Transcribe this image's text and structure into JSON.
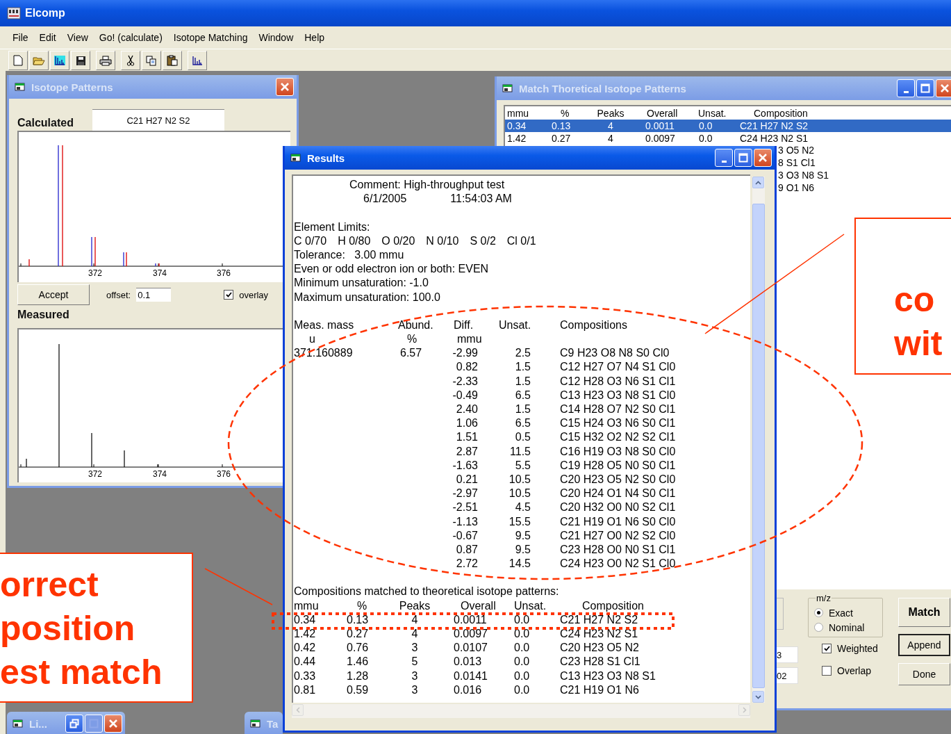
{
  "app": {
    "title": "Elcomp"
  },
  "menu": [
    "File",
    "Edit",
    "View",
    "Go! (calculate)",
    "Isotope Matching",
    "Window",
    "Help"
  ],
  "toolbar": [
    [
      {
        "kind": "new",
        "selected": false
      },
      {
        "kind": "open",
        "selected": false
      },
      {
        "kind": "spectrum",
        "selected": true
      },
      {
        "kind": "save",
        "selected": false
      }
    ],
    [
      {
        "kind": "print",
        "selected": false
      }
    ],
    [
      {
        "kind": "cut",
        "selected": false
      },
      {
        "kind": "copy",
        "selected": false
      },
      {
        "kind": "paste",
        "selected": false
      }
    ],
    [
      {
        "kind": "spectrum",
        "selected": false
      }
    ]
  ],
  "isotope_window": {
    "title": "Isotope Patterns",
    "calculated_label": "Calculated",
    "formula": "C21 H27 N2 S2",
    "calculated_ticks": [
      "372",
      "374",
      "376"
    ],
    "accept": "Accept",
    "offset_label": "offset:",
    "offset_value": "0.1",
    "overlay": {
      "label": "overlay",
      "checked": true
    },
    "measured_label": "Measured",
    "measured_ticks": [
      "372",
      "374",
      "376"
    ]
  },
  "match_window": {
    "title": "Match Thoretical Isotope Patterns",
    "columns": [
      "mmu",
      "%",
      "Peaks",
      "Overall",
      "Unsat.",
      "Composition"
    ],
    "rows": [
      {
        "mmu": "0.34",
        "pct": "0.13",
        "peaks": "4",
        "overall": "0.0011",
        "unsat": "0.0",
        "composition": "C21 H27 N2 S2",
        "selected": true
      },
      {
        "mmu": "1.42",
        "pct": "0.27",
        "peaks": "4",
        "overall": "0.0097",
        "unsat": "0.0",
        "composition": "C24 H23 N2 S1",
        "selected": false
      },
      {
        "composition": "3 O5 N2",
        "selected": false
      },
      {
        "composition": "8 S1 Cl1",
        "selected": false
      },
      {
        "composition": "3 O3 N8 S1",
        "selected": false
      },
      {
        "composition": "9 O1 N6",
        "selected": false
      }
    ],
    "mz_group": {
      "label": "m/z",
      "options": [
        {
          "label": "Exact",
          "selected": true
        },
        {
          "label": "Nominal",
          "selected": false
        }
      ]
    },
    "fields": [
      "3",
      "02"
    ],
    "checks": [
      {
        "label": "Weighted",
        "checked": true
      },
      {
        "label": "Overlap",
        "checked": false
      }
    ],
    "buttons": [
      {
        "label": "Match",
        "kind": "bold"
      },
      {
        "label": "Append",
        "kind": "default"
      },
      {
        "label": "Done",
        "kind": "normal"
      }
    ]
  },
  "results_window": {
    "title": "Results",
    "comment": "Comment: High-throughput test",
    "date": "6/1/2005",
    "time": "11:54:03 AM",
    "limits_heading": "Element Limits:",
    "limits": [
      "C 0/70",
      "H 0/80",
      "O 0/20",
      "N 0/10",
      "S 0/2",
      "Cl 0/1"
    ],
    "settings": [
      "Tolerance:   3.00 mmu",
      "Even or odd electron ion or both: EVEN",
      "Minimum unsaturation: -1.0",
      "Maximum unsaturation: 100.0"
    ],
    "columns": [
      [
        "Meas. mass",
        "u"
      ],
      [
        "Abund.",
        "%"
      ],
      [
        "Diff.",
        "mmu"
      ],
      [
        "Unsat."
      ],
      [
        "Compositions"
      ]
    ],
    "rows": [
      {
        "mass": "371.160889",
        "abund": "6.57",
        "diff": "-2.99",
        "unsat": "2.5",
        "composition": "C9 H23 O8 N8 S0 Cl0"
      },
      {
        "diff": "0.82",
        "unsat": "1.5",
        "composition": "C12 H27 O7 N4 S1 Cl0"
      },
      {
        "diff": "-2.33",
        "unsat": "1.5",
        "composition": "C12 H28 O3 N6 S1 Cl1"
      },
      {
        "diff": "-0.49",
        "unsat": "6.5",
        "composition": "C13 H23 O3 N8 S1 Cl0"
      },
      {
        "diff": "2.40",
        "unsat": "1.5",
        "composition": "C14 H28 O7 N2 S0 Cl1"
      },
      {
        "diff": "1.06",
        "unsat": "6.5",
        "composition": "C15 H24 O3 N6 S0 Cl1"
      },
      {
        "diff": "1.51",
        "unsat": "0.5",
        "composition": "C15 H32 O2 N2 S2 Cl1"
      },
      {
        "diff": "2.87",
        "unsat": "11.5",
        "composition": "C16 H19 O3 N8 S0 Cl0"
      },
      {
        "diff": "-1.63",
        "unsat": "5.5",
        "composition": "C19 H28 O5 N0 S0 Cl1"
      },
      {
        "diff": "0.21",
        "unsat": "10.5",
        "composition": "C20 H23 O5 N2 S0 Cl0"
      },
      {
        "diff": "-2.97",
        "unsat": "10.5",
        "composition": "C20 H24 O1 N4 S0 Cl1"
      },
      {
        "diff": "-2.51",
        "unsat": "4.5",
        "composition": "C20 H32 O0 N0 S2 Cl1"
      },
      {
        "diff": "-1.13",
        "unsat": "15.5",
        "composition": "C21 H19 O1 N6 S0 Cl0"
      },
      {
        "diff": "-0.67",
        "unsat": "9.5",
        "composition": "C21 H27 O0 N2 S2 Cl0"
      },
      {
        "diff": "0.87",
        "unsat": "9.5",
        "composition": "C23 H28 O0 N0 S1 Cl1"
      },
      {
        "diff": "2.72",
        "unsat": "14.5",
        "composition": "C24 H23 O0 N2 S1 Cl0"
      }
    ],
    "matched_heading": "Compositions matched to theoretical isotope patterns:",
    "matched_columns": [
      "mmu",
      "%",
      "Peaks",
      "Overall",
      "Unsat.",
      "Composition"
    ],
    "matched_rows": [
      [
        "0.34",
        "0.13",
        "4",
        "0.0011",
        "0.0",
        "C21 H27 N2 S2"
      ],
      [
        "1.42",
        "0.27",
        "4",
        "0.0097",
        "0.0",
        "C24 H23 N2 S1"
      ],
      [
        "0.42",
        "0.76",
        "3",
        "0.0107",
        "0.0",
        "C20 H23 O5 N2"
      ],
      [
        "0.44",
        "1.46",
        "5",
        "0.013",
        "0.0",
        "C23 H28 S1 Cl1"
      ],
      [
        "0.33",
        "1.28",
        "3",
        "0.0141",
        "0.0",
        "C13 H23 O3 N8 S1"
      ],
      [
        "0.81",
        "0.59",
        "3",
        "0.016",
        "0.0",
        "C21 H19 O1 N6"
      ]
    ]
  },
  "minimized": [
    {
      "title": "Li..."
    },
    {
      "title": "Ta"
    }
  ],
  "annotations": {
    "left_callout": [
      "orrect",
      "position",
      "est match"
    ],
    "right_callout": [
      "co",
      "wit"
    ]
  }
}
